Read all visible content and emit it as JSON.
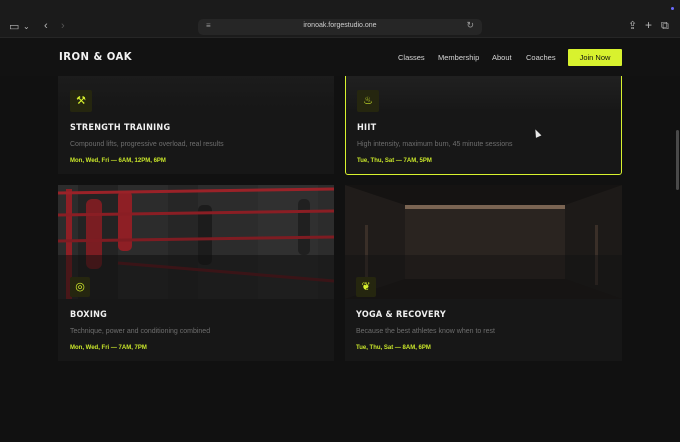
{
  "browser": {
    "url": "ironoak.forgestudio.one",
    "icons": {
      "sidebar": "sidebar-icon",
      "back": "chevron-left-icon",
      "forward": "chevron-right-icon",
      "reload": "reload-icon",
      "share": "share-icon",
      "new_tab": "plus-icon",
      "tabs": "tabs-icon"
    }
  },
  "nav": {
    "brand": "IRON & OAK",
    "links": [
      "Classes",
      "Membership",
      "About",
      "Coaches"
    ],
    "cta": "Join Now"
  },
  "colors": {
    "accent": "#d8f22e",
    "background": "#111111",
    "card": "#171717"
  },
  "classes": [
    {
      "title": "STRENGTH TRAINING",
      "description": "Compound lifts, progressive overload, real results",
      "schedule": "Mon, Wed, Fri — 6AM, 12PM, 6PM",
      "icon": "dumbbell-icon",
      "highlighted": false
    },
    {
      "title": "HIIT",
      "description": "High intensity, maximum burn, 45 minute sessions",
      "schedule": "Tue, Thu, Sat — 7AM, 5PM",
      "icon": "flame-icon",
      "highlighted": true
    },
    {
      "title": "BOXING",
      "description": "Technique, power and conditioning combined",
      "schedule": "Mon, Wed, Fri — 7AM, 7PM",
      "icon": "target-icon",
      "highlighted": false
    },
    {
      "title": "YOGA & RECOVERY",
      "description": "Because the best athletes know when to rest",
      "schedule": "Tue, Thu, Sat — 8AM, 6PM",
      "icon": "leaf-icon",
      "highlighted": false
    }
  ]
}
